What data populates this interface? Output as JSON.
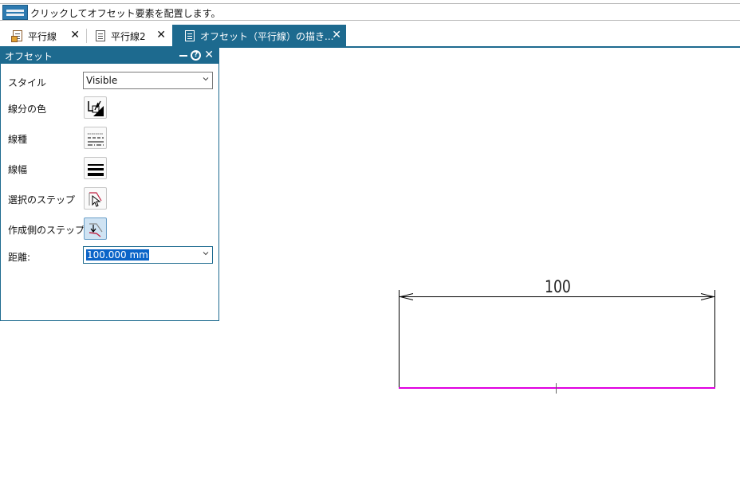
{
  "prompt": {
    "text": "クリックしてオフセット要素を配置します。",
    "icon": "command-icon"
  },
  "tabs": [
    {
      "label": "平行線",
      "close": "✕",
      "icon": "document-icon",
      "active": false
    },
    {
      "label": "平行線2",
      "close": "✕",
      "icon": "document-icon",
      "active": false
    },
    {
      "label": "オフセット（平行線）の描き...",
      "close": "✕",
      "icon": "document-icon",
      "active": true
    }
  ],
  "panel": {
    "title": "オフセット",
    "help": "?",
    "close": "✕",
    "rows": {
      "style_label": "スタイル",
      "style_value": "Visible",
      "color_label": "線分の色",
      "linetype_label": "線種",
      "linewidth_label": "線幅",
      "select_step_label": "選択のステップ",
      "side_step_label": "作成側のステップ",
      "distance_label": "距離:",
      "distance_value": "100.000 mm"
    }
  },
  "drawing": {
    "dimension_text": "100",
    "colors": {
      "line": "#000000",
      "offset_line": "#e000e0",
      "accent": "#1d6a8f"
    }
  }
}
